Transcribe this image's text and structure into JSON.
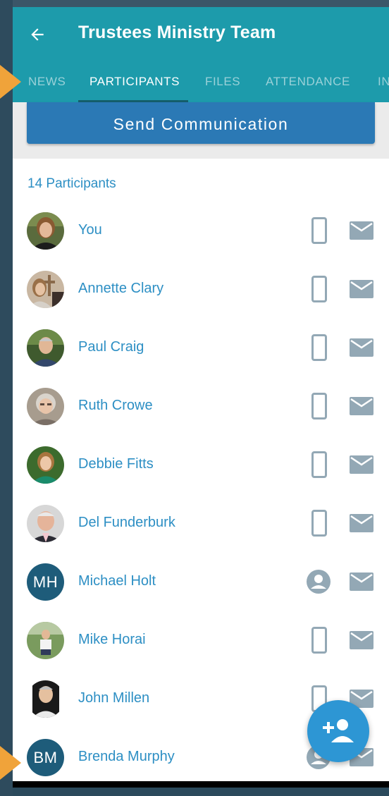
{
  "header": {
    "title": "Trustees Ministry Team"
  },
  "tabs": [
    {
      "label": "NEWS",
      "active": false
    },
    {
      "label": "PARTICIPANTS",
      "active": true
    },
    {
      "label": "FILES",
      "active": false
    },
    {
      "label": "ATTENDANCE",
      "active": false
    },
    {
      "label": "IN",
      "active": false
    }
  ],
  "actions": {
    "send_label": "Send Communication"
  },
  "participants": {
    "count_label": "14 Participants",
    "items": [
      {
        "name": "You",
        "avatar": "photo",
        "contact_icon": "phone-icon"
      },
      {
        "name": "Annette Clary",
        "avatar": "photo",
        "contact_icon": "phone-icon"
      },
      {
        "name": "Paul Craig",
        "avatar": "photo",
        "contact_icon": "phone-icon"
      },
      {
        "name": "Ruth Crowe",
        "avatar": "photo",
        "contact_icon": "phone-icon"
      },
      {
        "name": "Debbie Fitts",
        "avatar": "photo",
        "contact_icon": "phone-icon"
      },
      {
        "name": "Del Funderburk",
        "avatar": "photo",
        "contact_icon": "phone-icon"
      },
      {
        "name": "Michael Holt",
        "avatar": "initials",
        "initials": "MH",
        "contact_icon": "person-icon"
      },
      {
        "name": "Mike Horai",
        "avatar": "photo",
        "contact_icon": "phone-icon"
      },
      {
        "name": "John Millen",
        "avatar": "photo",
        "contact_icon": "phone-icon"
      },
      {
        "name": "Brenda Murphy",
        "avatar": "initials",
        "initials": "BM",
        "contact_icon": "person-icon"
      }
    ]
  },
  "colors": {
    "app_bar": "#1d9bab",
    "accent_text": "#2d8fc4",
    "send_button": "#2b79b5",
    "fab": "#2d96d4",
    "icon_gray": "#93a8b5",
    "initials_bg": "#1e5c7a"
  },
  "icons": {
    "back": "arrow-left-icon",
    "email": "mail-icon",
    "fab": "add-person-icon"
  }
}
